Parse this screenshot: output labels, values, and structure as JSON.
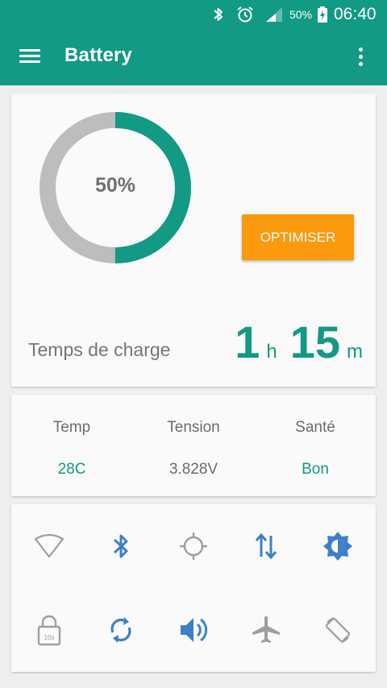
{
  "status_bar": {
    "battery_percent": "50%",
    "time": "06:40",
    "icons": [
      "bluetooth-icon",
      "alarm-icon",
      "signal-icon",
      "battery-charging-icon"
    ]
  },
  "app_bar": {
    "title": "Battery",
    "menu_icon": "hamburger-menu-icon",
    "overflow_icon": "more-vertical-icon"
  },
  "battery_card": {
    "level_label": "50%",
    "level_fraction": 0.5,
    "optimize_button": "OPTIMISER",
    "charge_time_label": "Temps de charge",
    "charge_hours": "1",
    "hours_unit": "h",
    "charge_minutes": "15",
    "minutes_unit": "m"
  },
  "stats": {
    "temp_label": "Temp",
    "temp_value": "28C",
    "voltage_label": "Tension",
    "voltage_value": "3.828V",
    "health_label": "Santé",
    "health_value": "Bon"
  },
  "quick_settings": {
    "row1": [
      "wifi-icon",
      "bluetooth-icon",
      "location-icon",
      "mobile-data-icon",
      "brightness-icon"
    ],
    "row2": [
      "screen-timeout-lock-icon",
      "sync-icon",
      "volume-icon",
      "airplane-mode-icon",
      "auto-rotate-icon"
    ],
    "timeout_badge": "10s"
  },
  "colors": {
    "primary": "#129a84",
    "accent": "#fb9a0c",
    "gauge_track": "#bdbdbd",
    "value_text": "#129a84",
    "icon_blue": "#3d80c8",
    "icon_gray": "#9e9e9e"
  }
}
